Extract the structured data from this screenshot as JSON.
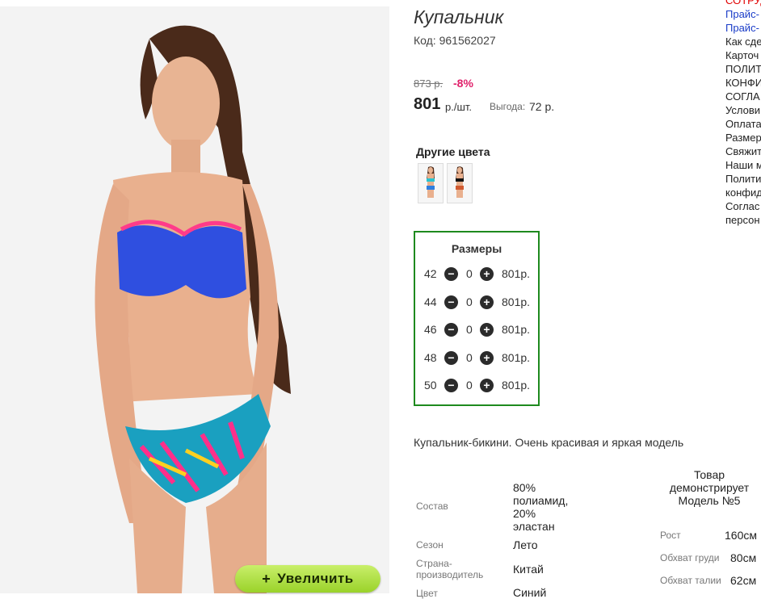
{
  "product": {
    "title": "Купальник",
    "code": "Код: 961562027",
    "old_price": "873 р.",
    "discount": "-8%",
    "price": "801",
    "price_unit": "р./шт.",
    "profit_label": "Выгода:",
    "profit_value": "72 р.",
    "zoom_label": "Увеличить",
    "zoom_icon": "+",
    "description": "Купальник-бикини. Очень красивая и яркая модель"
  },
  "other_colors": {
    "title": "Другие цвета",
    "swatches": [
      "turquoise-swimsuit-thumbnail",
      "black-swimsuit-thumbnail"
    ]
  },
  "sizes": {
    "title": "Размеры",
    "rows": [
      {
        "size": "42",
        "qty": "0",
        "price": "801р."
      },
      {
        "size": "44",
        "qty": "0",
        "price": "801р."
      },
      {
        "size": "46",
        "qty": "0",
        "price": "801р."
      },
      {
        "size": "48",
        "qty": "0",
        "price": "801р."
      },
      {
        "size": "50",
        "qty": "0",
        "price": "801р."
      }
    ]
  },
  "specs": [
    {
      "label": "Состав",
      "value": "80% полиамид, 20% эластан"
    },
    {
      "label": "Сезон",
      "value": "Лето"
    },
    {
      "label": "Страна-производитель",
      "value": "Китай"
    },
    {
      "label": "Цвет",
      "value": "Синий"
    }
  ],
  "model": {
    "title": "Товар демонстрирует Модель №5",
    "measurements": [
      {
        "label": "Рост",
        "value": "160см"
      },
      {
        "label": "Обхват груди",
        "value": "80см"
      },
      {
        "label": "Обхват талии",
        "value": "62см"
      }
    ]
  },
  "sidebar_links": [
    "СОТРУД",
    "Прайс-",
    "Прайс-",
    "Как сде",
    "Карточ",
    "ПОЛИТ",
    "КОНФИ",
    "СОГЛА",
    "Услови",
    "Оплата",
    "Размер",
    "Свяжит",
    "Наши м",
    "Полити",
    "конфид",
    "Соглас",
    "персон"
  ],
  "colors": {
    "accent_green": "#9ad22a",
    "sizes_border": "#1e8a1e",
    "discount": "#e0206a",
    "link_blue": "#1a3cc8",
    "link_red": "#e00000",
    "swimsuit_blue": "#2f4fe0"
  }
}
